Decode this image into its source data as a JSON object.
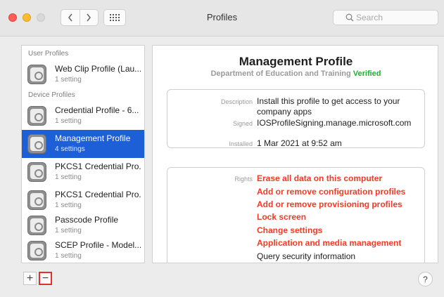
{
  "window": {
    "title": "Profiles",
    "search_placeholder": "Search"
  },
  "sidebar": {
    "sections": [
      {
        "label": "User Profiles"
      },
      {
        "label": "Device Profiles"
      }
    ],
    "items": [
      {
        "name": "Web Clip Profile (Lau...",
        "sub": "1 setting",
        "icon": "profile-icon"
      },
      {
        "name": "Credential Profile - 6...",
        "sub": "1 setting",
        "icon": "profile-icon"
      },
      {
        "name": "Management Profile",
        "sub": "4 settings",
        "icon": "profile-icon",
        "selected": true
      },
      {
        "name": "PKCS1 Credential Pro...",
        "sub": "1 setting",
        "icon": "profile-icon"
      },
      {
        "name": "PKCS1 Credential Pro...",
        "sub": "1 setting",
        "icon": "profile-icon"
      },
      {
        "name": "Passcode Profile",
        "sub": "1 setting",
        "icon": "profile-icon"
      },
      {
        "name": "SCEP Profile - Model...",
        "sub": "1 setting",
        "icon": "profile-icon"
      }
    ]
  },
  "detail": {
    "title": "Management Profile",
    "organization": "Department of Education and Training",
    "verified": "Verified",
    "description_label": "Description",
    "description": "Install this profile to get access to your company apps",
    "signed_label": "Signed",
    "signed": "IOSProfileSigning.manage.microsoft.com",
    "installed_label": "Installed",
    "installed": "1 Mar 2021 at 9:52 am",
    "rights_label": "Rights",
    "rights": [
      "Erase all data on this computer",
      "Add or remove configuration profiles",
      "Add or remove provisioning profiles",
      "Lock screen",
      "Change settings",
      "Application and media management",
      "Query security information"
    ]
  },
  "footer": {
    "add_label": "+",
    "remove_label": "−",
    "help_label": "?"
  },
  "colors": {
    "selection": "#1d5fd6",
    "verified": "#1fb035",
    "rights_warning": "#f33a25",
    "highlight_box": "#e0312b"
  }
}
